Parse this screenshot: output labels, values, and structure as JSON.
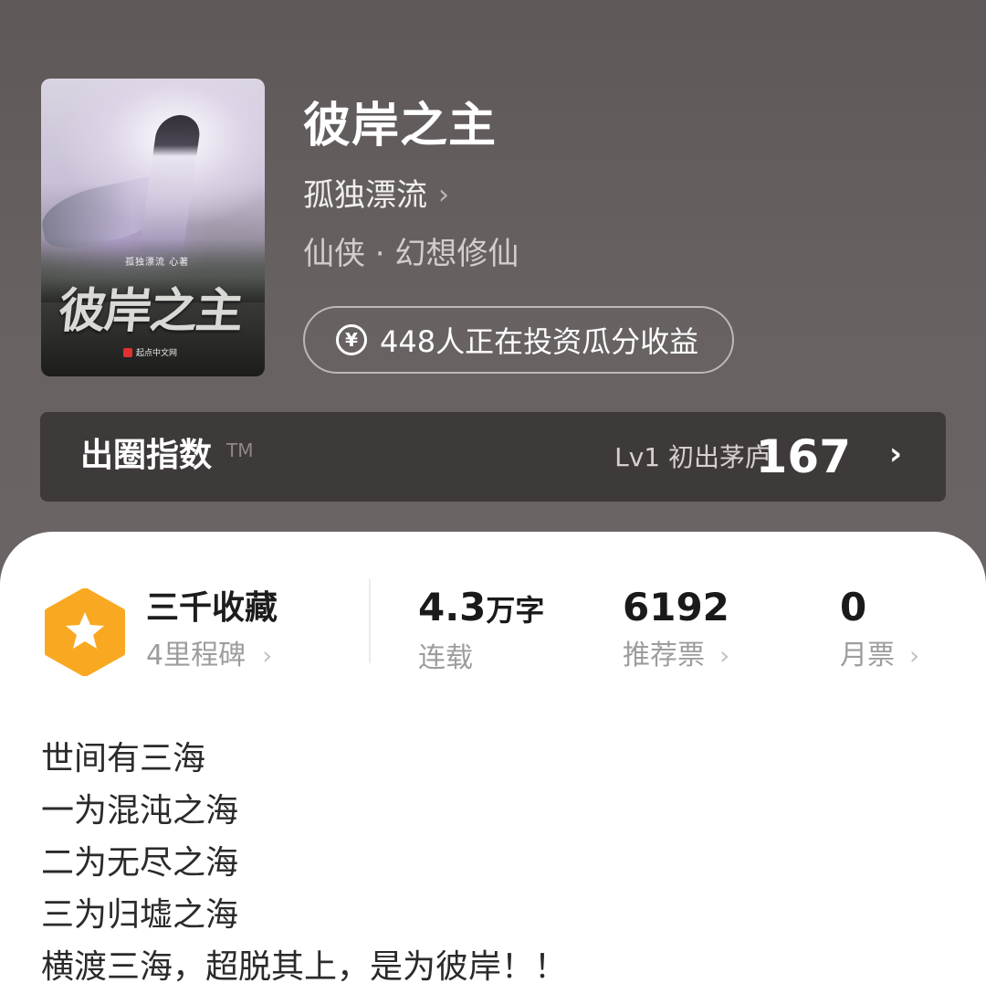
{
  "book": {
    "title": "彼岸之主",
    "author": "孤独漂流",
    "genre": "仙侠 · 幻想修仙",
    "cover": {
      "title_art": "彼岸之主",
      "author_art": "孤独漂流 心著",
      "publisher": "起点中文网"
    }
  },
  "invest": {
    "label": "448人正在投资瓜分收益",
    "icon": "yen-circle-icon"
  },
  "breakout_index": {
    "label": "出圈指数",
    "tm": "TM",
    "level": "Lv1 初出茅庐",
    "score": "167"
  },
  "stats": {
    "collection": {
      "title": "三千收藏",
      "subtitle": "4里程碑",
      "badge_color": "#f9a822"
    },
    "words": {
      "value": "4.3",
      "unit": "万字",
      "label": "连载"
    },
    "recommend": {
      "value": "6192",
      "label": "推荐票"
    },
    "monthly": {
      "value": "0",
      "label": "月票"
    }
  },
  "synopsis": [
    "世间有三海",
    "一为混沌之海",
    "二为无尽之海",
    "三为归墟之海",
    "横渡三海，超脱其上，是为彼岸！！"
  ],
  "colors": {
    "header_bg": "#676161",
    "index_bar_bg": "#3e3a3a",
    "sheet_bg": "#ffffff",
    "accent_badge": "#f9a822"
  }
}
